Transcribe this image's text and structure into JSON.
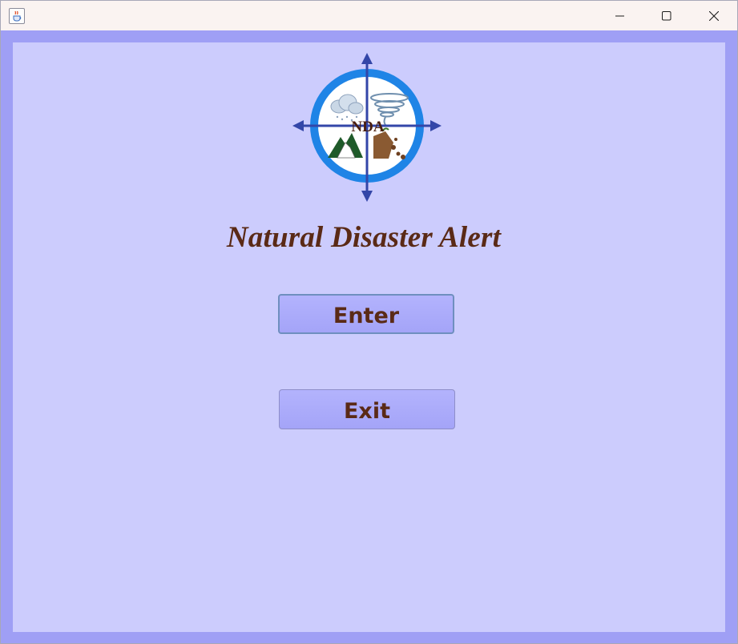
{
  "window": {
    "title": ""
  },
  "logo": {
    "text": "NDA"
  },
  "main": {
    "title": "Natural Disaster Alert",
    "enter_label": "Enter",
    "exit_label": "Exit"
  }
}
